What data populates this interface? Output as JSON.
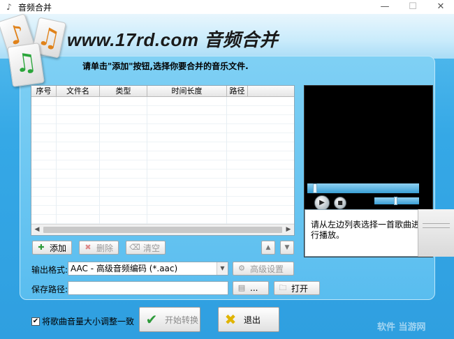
{
  "window": {
    "title": "音频合并",
    "min_icon": "minimize-icon",
    "max_icon": "maximize-icon",
    "close_icon": "close-icon"
  },
  "header": {
    "brand": "www.17rd.com 音频合并",
    "logo_icons": [
      "music-note-icon",
      "music-note-icon",
      "music-note-icon"
    ]
  },
  "instruction": "请单击\"添加\"按钮,选择你要合并的音乐文件.",
  "file_list": {
    "columns": [
      "序号",
      "文件名",
      "类型",
      "时间长度",
      "路径"
    ],
    "rows": []
  },
  "list_buttons": {
    "add": "添加",
    "delete": "删除",
    "clear": "清空"
  },
  "output": {
    "format_label": "输出格式:",
    "format_value": "AAC - 高级音频编码 (*.aac)",
    "advanced_settings": "高级设置",
    "path_label": "保存路径:",
    "path_value": "",
    "browse": "...",
    "open": "打开"
  },
  "player": {
    "hint": "请从左边列表选择一首歌曲进行播放。"
  },
  "footer": {
    "normalize_label": "将歌曲音量大小调整一致",
    "normalize_checked": true,
    "start": "开始转换",
    "exit": "退出",
    "watermark": "软件 当游网"
  }
}
